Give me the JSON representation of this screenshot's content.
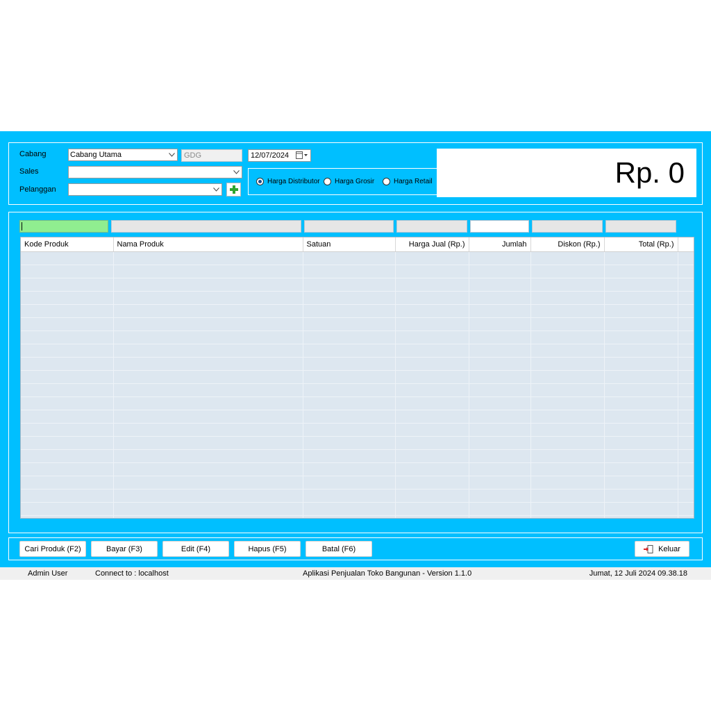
{
  "header": {
    "cabang_label": "Cabang",
    "cabang_value": "Cabang Utama",
    "gudang_value": "GDG",
    "tanggal_value": "12/07/2024",
    "sales_label": "Sales",
    "sales_value": "",
    "pelanggan_label": "Pelanggan",
    "pelanggan_value": ""
  },
  "harga_options": [
    {
      "label": "Harga Distributor",
      "selected": true
    },
    {
      "label": "Harga Grosir",
      "selected": false
    },
    {
      "label": "Harga Retail",
      "selected": false
    }
  ],
  "total_display": "Rp. 0",
  "table": {
    "columns": [
      "Kode Produk",
      "Nama Produk",
      "Satuan",
      "Harga Jual (Rp.)",
      "Jumlah",
      "Diskon (Rp.)",
      "Total (Rp.)"
    ],
    "rows": []
  },
  "buttons": {
    "cari_produk": "Cari Produk (F2)",
    "bayar": "Bayar (F3)",
    "edit": "Edit (F4)",
    "hapus": "Hapus (F5)",
    "batal": "Batal (F6)",
    "keluar": "Keluar"
  },
  "status": {
    "user": "Admin User",
    "connection": "Connect to : localhost",
    "app_title": "Aplikasi Penjualan Toko Bangunan - Version 1.1.0",
    "datetime": "Jumat, 12 Juli 2024 09.38.18"
  },
  "colors": {
    "window_bg": "#00bfff",
    "entry_active": "#90ee90",
    "grid_bg": "#dde7f0"
  },
  "icons": {
    "add_customer": "green-plus-icon",
    "calendar": "calendar-icon",
    "exit": "exit-door-icon"
  }
}
